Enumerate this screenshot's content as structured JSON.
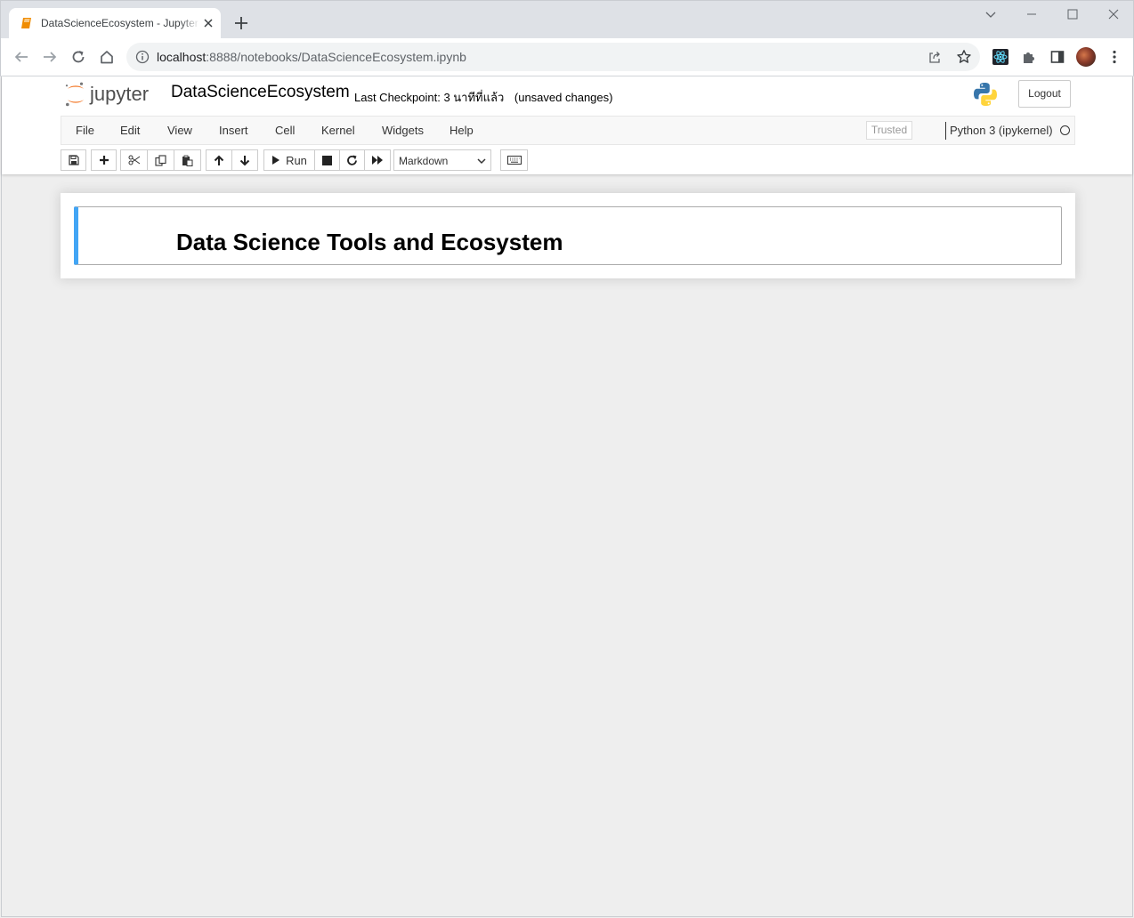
{
  "browser": {
    "tab_title": "DataScienceEcosystem - Jupyter Notebook",
    "url_host": "localhost",
    "url_rest": ":8888/notebooks/DataScienceEcosystem.ipynb"
  },
  "jupyter": {
    "logo_text": "jupyter",
    "notebook_name": "DataScienceEcosystem",
    "checkpoint": "Last Checkpoint: 3 นาทีที่แล้ว",
    "unsaved": "(unsaved changes)",
    "logout_label": "Logout",
    "menu": [
      "File",
      "Edit",
      "View",
      "Insert",
      "Cell",
      "Kernel",
      "Widgets",
      "Help"
    ],
    "trusted_label": "Trusted",
    "kernel_name": "Python 3 (ipykernel)",
    "run_label": "Run",
    "cell_type": "Markdown"
  },
  "notebook": {
    "cells": [
      {
        "type": "markdown",
        "rendered_heading": "Data Science Tools and Ecosystem"
      }
    ]
  },
  "colors": {
    "cell_selected_border": "#42a5f5",
    "jupyter_orange": "#f37726",
    "tab_favicon": "#f08c00"
  }
}
